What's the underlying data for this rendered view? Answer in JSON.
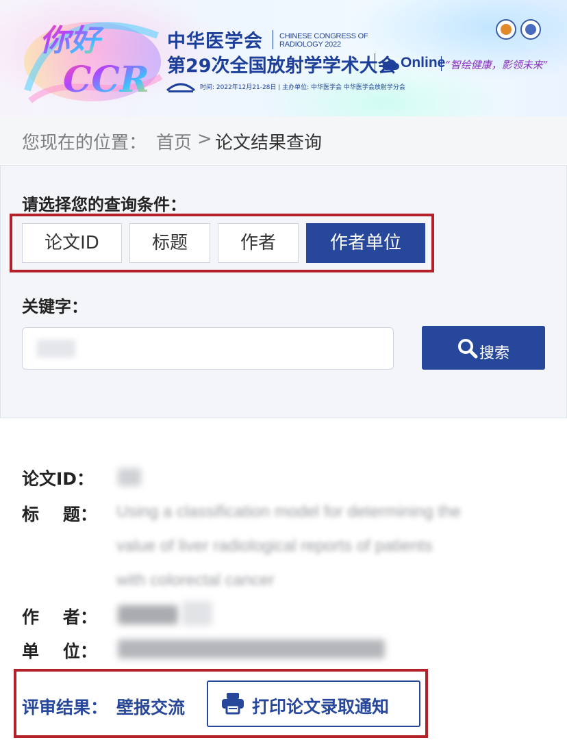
{
  "banner": {
    "logo_text_1": "你好",
    "logo_text_2": "CCR",
    "org_title": "中华医学会",
    "org_en": "CHINESE CONGRESS OF RADIOLOGY 2022",
    "conference_title": "第29次全国放射学学术大会",
    "online": "Online",
    "slogan": "“智绘健康，影领未来”",
    "meta": "时间: 2022年12月21-28日 | 主办单位: 中华医学会  中华医学会放射学分会"
  },
  "breadcrumb": {
    "prefix": "您现在的位置：",
    "home": "首页",
    "separator": ">",
    "current": "论文结果查询"
  },
  "query": {
    "condition_label": "请选择您的查询条件：",
    "filters": [
      "论文ID",
      "标题",
      "作者",
      "作者单位"
    ],
    "selected_filter": "作者单位",
    "keyword_label": "关键字：",
    "search_label": "搜索"
  },
  "result": {
    "id_label": "论文ID：",
    "title_label": "标    题：",
    "title_lines": [
      "Using a classification model for determining the",
      "value of liver radiological reports of patients",
      "with colorectal cancer"
    ],
    "author_label": "作    者：",
    "unit_label": "单    位：",
    "review_label": "评审结果：",
    "review_value": "壁报交流",
    "print_label": "打印论文录取通知"
  },
  "colors": {
    "primary": "#27479b",
    "highlight_border": "#b3202a"
  }
}
